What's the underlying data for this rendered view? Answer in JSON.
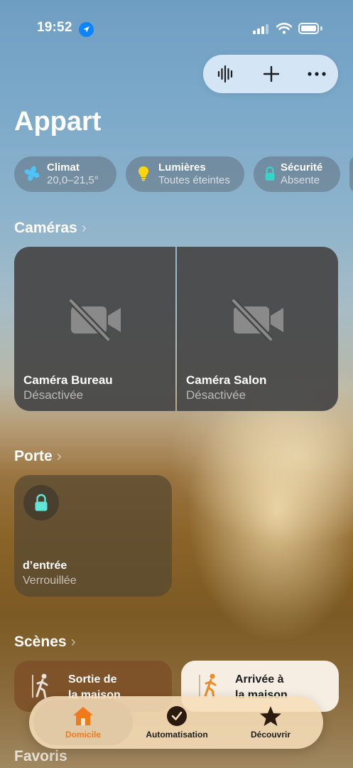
{
  "status_bar": {
    "time": "19:52"
  },
  "title": "Appart",
  "top_actions": [
    {
      "name": "voice-control-icon"
    },
    {
      "name": "add-icon"
    },
    {
      "name": "more-icon"
    }
  ],
  "chips": [
    {
      "label": "Climat",
      "value": "20,0–21,5°",
      "icon": "fan-icon",
      "color": "#4fc3f7"
    },
    {
      "label": "Lumières",
      "value": "Toutes éteintes",
      "icon": "lightbulb-icon",
      "color": "#ffd60a"
    },
    {
      "label": "Sécurité",
      "value": "Absente",
      "icon": "lock-icon",
      "color": "#30d8c8"
    }
  ],
  "sections": {
    "cameras": "Caméras",
    "door": "Porte",
    "scenes": "Scènes",
    "favorites": "Favoris"
  },
  "cameras": [
    {
      "name": "Caméra Bureau",
      "status": "Désactivée"
    },
    {
      "name": "Caméra Salon",
      "status": "Désactivée"
    }
  ],
  "door": {
    "name": "d’entrée",
    "status": "Verrouillée"
  },
  "scenes": [
    {
      "label_line1": "Sortie de",
      "label_line2": "la maison"
    },
    {
      "label_line1": "Arrivée à",
      "label_line2": "la maison"
    }
  ],
  "tabs": [
    {
      "label": "Domicile",
      "active": true,
      "color": "#f07a1a"
    },
    {
      "label": "Automatisation",
      "active": false
    },
    {
      "label": "Découvrir",
      "active": false
    }
  ]
}
